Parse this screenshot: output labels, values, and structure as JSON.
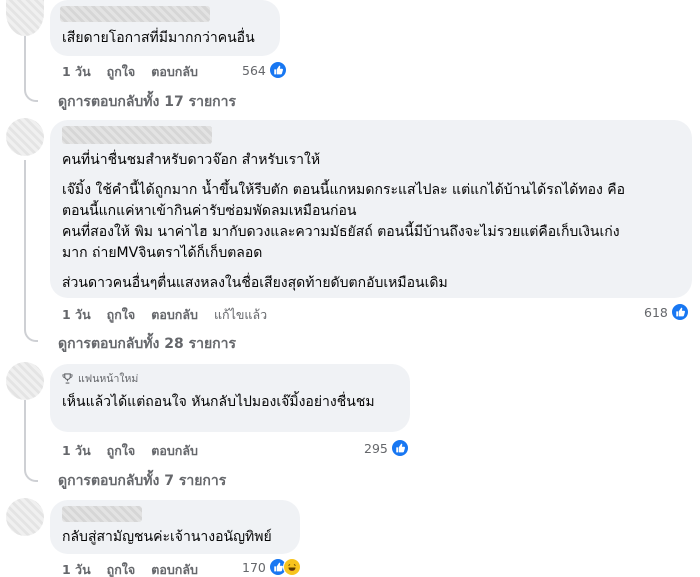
{
  "comments": [
    {
      "text": [
        "เสียดายโอกาสที่มีมากกว่าคนอื่น"
      ],
      "time": "1 วัน",
      "like_label": "ถูกใจ",
      "reply_label": "ตอบกลับ",
      "reactions": "564",
      "view_replies": "ดูการตอบกลับทั้ง 17 รายการ"
    },
    {
      "text": [
        "คนที่น่าชื่นชมสำหรับดาวจ๊อก สำหรับเราให้",
        "เจ๊มิ้ง ใช้คำนี้ได้ถูกมาก น้ำขึ้นให้รีบตัก ตอนนี้แกหมดกระแสไปละ แต่แกได้บ้านได้รถได้ทอง คือ",
        "ตอนนี้แกแค่หาเข้ากินค่ารับซ่อมพัดลมเหมือนก่อน",
        "คนที่สองให้ พิม นาค่าไฮ มากับดวงและความมัธยัสถ์ ตอนนี้มีบ้านถึงจะไม่รวยแต่คือเก็บเงินเก่ง",
        "มาก ถ่ายMVจินตราได้ก็เก็บตลอด",
        "ส่วนดาวคนอื่นๆตื่นแสงหลงในชื่อเสียงสุดท้ายดับตกอับเหมือนเดิม"
      ],
      "time": "1 วัน",
      "like_label": "ถูกใจ",
      "reply_label": "ตอบกลับ",
      "edited_label": "แก้ไขแล้ว",
      "reactions": "618",
      "view_replies": "ดูการตอบกลับทั้ง 28 รายการ"
    },
    {
      "badge": "แฟนหน้าใหม่",
      "text": [
        "เห็นแล้วได้แต่ถอนใจ หันกลับไปมองเจ๊มิ้งอย่างชื่นชม"
      ],
      "time": "1 วัน",
      "like_label": "ถูกใจ",
      "reply_label": "ตอบกลับ",
      "reactions": "295",
      "view_replies": "ดูการตอบกลับทั้ง 7 รายการ"
    },
    {
      "text": [
        "กลับสู่สามัญชนค่ะเจ้านางอนัญทิพย์"
      ],
      "time": "1 วัน",
      "like_label": "ถูกใจ",
      "reply_label": "ตอบกลับ",
      "reactions": "170"
    }
  ],
  "colors": {
    "bubble": "#f0f2f5",
    "meta": "#65676b",
    "like": "#1877f2",
    "text": "#050505"
  },
  "icons": [
    "like-icon",
    "haha-icon",
    "trophy-icon"
  ]
}
